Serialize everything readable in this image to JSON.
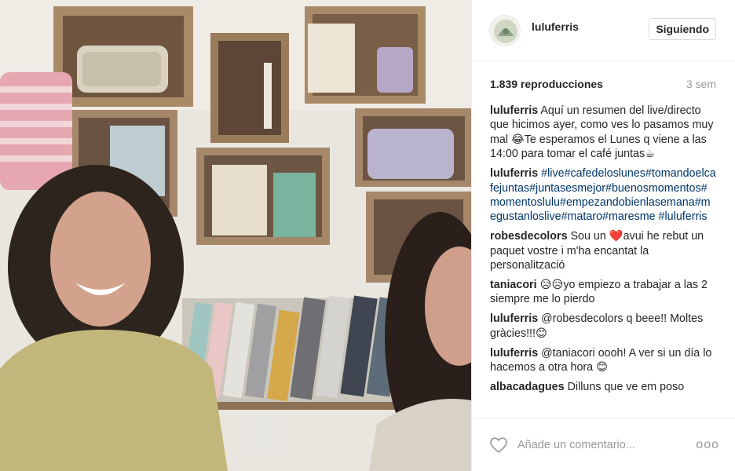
{
  "header": {
    "username": "luluferris",
    "follow_label": "Siguiendo"
  },
  "stats": {
    "views": "1.839 reproducciones",
    "ago": "3 sem"
  },
  "comments": [
    {
      "user": "luluferris",
      "text": "Aquí un resumen del live/directo que hicimos ayer, como ves lo pasamos muy mal 😂Te esperamos el Lunes q viene a las 14:00 para tomar el café juntas☕"
    },
    {
      "user": "luluferris",
      "text": "#live#cafedeloslunes#tomandoelcafejuntas#juntasesmejor#buenosmomentos#momentoslulu#empezandobienlasemana#megustanloslive#mataro#maresme #luluferris"
    },
    {
      "user": "robesdecolors",
      "text": "Sou un ❤️avui he rebut un paquet vostre i m'ha encantat la personalització"
    },
    {
      "user": "taniacori",
      "text": "😥😥yo empiezo a trabajar a las 2 siempre me lo pierdo"
    },
    {
      "user": "luluferris",
      "text": "@robesdecolors q beee!! Moltes gràcies!!!😊"
    },
    {
      "user": "luluferris",
      "text": "@taniacori oooh! A ver si un día lo hacemos a otra hora 😊"
    },
    {
      "user": "albacadagues",
      "text": "Dilluns que ve em poso"
    }
  ],
  "footer": {
    "placeholder": "Añade un comentario...",
    "more": "ooo"
  },
  "colors": {
    "text": "#262626",
    "muted": "#999999",
    "hashtag": "#003569",
    "border": "#efefef"
  }
}
